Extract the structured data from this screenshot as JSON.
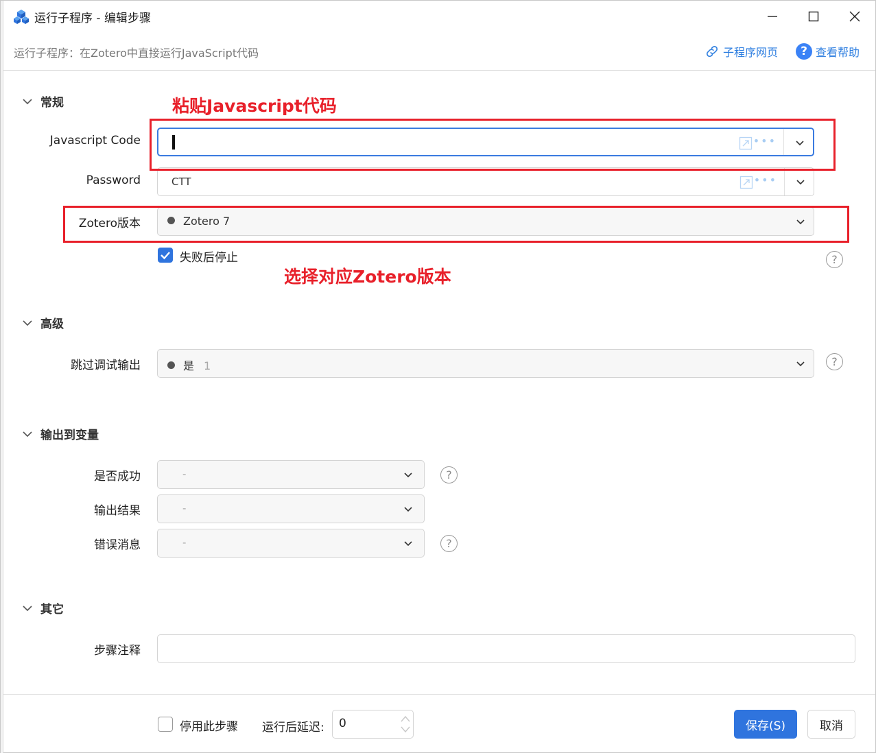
{
  "window": {
    "title": "运行子程序 - 编辑步骤"
  },
  "subheader": {
    "subtitle": "运行子程序：在Zotero中直接运行JavaScript代码",
    "subprogram_link": "子程序网页",
    "help_link": "查看帮助"
  },
  "sections": {
    "general": "常规",
    "advanced": "高级",
    "output": "输出到变量",
    "other": "其它"
  },
  "general": {
    "js_code_label": "Javascript Code",
    "js_code_value": "",
    "password_label": "Password",
    "password_value": "CTT",
    "zotero_label": "Zotero版本",
    "zotero_value": "Zotero 7",
    "stop_on_fail_label": "失败后停止",
    "stop_on_fail_checked": true
  },
  "advanced": {
    "skip_debug_label": "跳过调试输出",
    "skip_debug_value": "是",
    "skip_debug_extra": "1"
  },
  "output": {
    "success_label": "是否成功",
    "success_value": "-",
    "result_label": "输出结果",
    "result_value": "-",
    "error_label": "错误消息",
    "error_value": "-"
  },
  "other": {
    "note_label": "步骤注释",
    "note_value": ""
  },
  "annotations": {
    "paste_js": "粘贴Javascript代码",
    "choose_zotero": "选择对应Zotero版本"
  },
  "footer": {
    "disable_label": "停用此步骤",
    "disable_checked": false,
    "delay_label": "运行后延迟:",
    "delay_value": "0",
    "save_label": "保存(S)",
    "cancel_label": "取消"
  },
  "colors": {
    "accent": "#2f74de",
    "link": "#2f7fe0",
    "annotation_red": "#e8202a"
  }
}
